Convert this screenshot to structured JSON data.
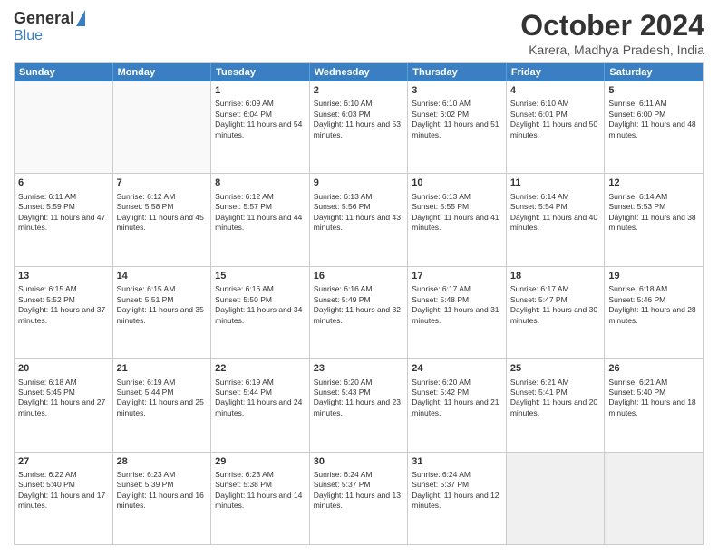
{
  "logo": {
    "general": "General",
    "blue": "Blue"
  },
  "header": {
    "month": "October 2024",
    "location": "Karera, Madhya Pradesh, India"
  },
  "weekdays": [
    "Sunday",
    "Monday",
    "Tuesday",
    "Wednesday",
    "Thursday",
    "Friday",
    "Saturday"
  ],
  "weeks": [
    [
      {
        "day": "",
        "sunrise": "",
        "sunset": "",
        "daylight": "",
        "empty": true
      },
      {
        "day": "",
        "sunrise": "",
        "sunset": "",
        "daylight": "",
        "empty": true
      },
      {
        "day": "1",
        "sunrise": "Sunrise: 6:09 AM",
        "sunset": "Sunset: 6:04 PM",
        "daylight": "Daylight: 11 hours and 54 minutes.",
        "empty": false
      },
      {
        "day": "2",
        "sunrise": "Sunrise: 6:10 AM",
        "sunset": "Sunset: 6:03 PM",
        "daylight": "Daylight: 11 hours and 53 minutes.",
        "empty": false
      },
      {
        "day": "3",
        "sunrise": "Sunrise: 6:10 AM",
        "sunset": "Sunset: 6:02 PM",
        "daylight": "Daylight: 11 hours and 51 minutes.",
        "empty": false
      },
      {
        "day": "4",
        "sunrise": "Sunrise: 6:10 AM",
        "sunset": "Sunset: 6:01 PM",
        "daylight": "Daylight: 11 hours and 50 minutes.",
        "empty": false
      },
      {
        "day": "5",
        "sunrise": "Sunrise: 6:11 AM",
        "sunset": "Sunset: 6:00 PM",
        "daylight": "Daylight: 11 hours and 48 minutes.",
        "empty": false
      }
    ],
    [
      {
        "day": "6",
        "sunrise": "Sunrise: 6:11 AM",
        "sunset": "Sunset: 5:59 PM",
        "daylight": "Daylight: 11 hours and 47 minutes.",
        "empty": false
      },
      {
        "day": "7",
        "sunrise": "Sunrise: 6:12 AM",
        "sunset": "Sunset: 5:58 PM",
        "daylight": "Daylight: 11 hours and 45 minutes.",
        "empty": false
      },
      {
        "day": "8",
        "sunrise": "Sunrise: 6:12 AM",
        "sunset": "Sunset: 5:57 PM",
        "daylight": "Daylight: 11 hours and 44 minutes.",
        "empty": false
      },
      {
        "day": "9",
        "sunrise": "Sunrise: 6:13 AM",
        "sunset": "Sunset: 5:56 PM",
        "daylight": "Daylight: 11 hours and 43 minutes.",
        "empty": false
      },
      {
        "day": "10",
        "sunrise": "Sunrise: 6:13 AM",
        "sunset": "Sunset: 5:55 PM",
        "daylight": "Daylight: 11 hours and 41 minutes.",
        "empty": false
      },
      {
        "day": "11",
        "sunrise": "Sunrise: 6:14 AM",
        "sunset": "Sunset: 5:54 PM",
        "daylight": "Daylight: 11 hours and 40 minutes.",
        "empty": false
      },
      {
        "day": "12",
        "sunrise": "Sunrise: 6:14 AM",
        "sunset": "Sunset: 5:53 PM",
        "daylight": "Daylight: 11 hours and 38 minutes.",
        "empty": false
      }
    ],
    [
      {
        "day": "13",
        "sunrise": "Sunrise: 6:15 AM",
        "sunset": "Sunset: 5:52 PM",
        "daylight": "Daylight: 11 hours and 37 minutes.",
        "empty": false
      },
      {
        "day": "14",
        "sunrise": "Sunrise: 6:15 AM",
        "sunset": "Sunset: 5:51 PM",
        "daylight": "Daylight: 11 hours and 35 minutes.",
        "empty": false
      },
      {
        "day": "15",
        "sunrise": "Sunrise: 6:16 AM",
        "sunset": "Sunset: 5:50 PM",
        "daylight": "Daylight: 11 hours and 34 minutes.",
        "empty": false
      },
      {
        "day": "16",
        "sunrise": "Sunrise: 6:16 AM",
        "sunset": "Sunset: 5:49 PM",
        "daylight": "Daylight: 11 hours and 32 minutes.",
        "empty": false
      },
      {
        "day": "17",
        "sunrise": "Sunrise: 6:17 AM",
        "sunset": "Sunset: 5:48 PM",
        "daylight": "Daylight: 11 hours and 31 minutes.",
        "empty": false
      },
      {
        "day": "18",
        "sunrise": "Sunrise: 6:17 AM",
        "sunset": "Sunset: 5:47 PM",
        "daylight": "Daylight: 11 hours and 30 minutes.",
        "empty": false
      },
      {
        "day": "19",
        "sunrise": "Sunrise: 6:18 AM",
        "sunset": "Sunset: 5:46 PM",
        "daylight": "Daylight: 11 hours and 28 minutes.",
        "empty": false
      }
    ],
    [
      {
        "day": "20",
        "sunrise": "Sunrise: 6:18 AM",
        "sunset": "Sunset: 5:45 PM",
        "daylight": "Daylight: 11 hours and 27 minutes.",
        "empty": false
      },
      {
        "day": "21",
        "sunrise": "Sunrise: 6:19 AM",
        "sunset": "Sunset: 5:44 PM",
        "daylight": "Daylight: 11 hours and 25 minutes.",
        "empty": false
      },
      {
        "day": "22",
        "sunrise": "Sunrise: 6:19 AM",
        "sunset": "Sunset: 5:44 PM",
        "daylight": "Daylight: 11 hours and 24 minutes.",
        "empty": false
      },
      {
        "day": "23",
        "sunrise": "Sunrise: 6:20 AM",
        "sunset": "Sunset: 5:43 PM",
        "daylight": "Daylight: 11 hours and 23 minutes.",
        "empty": false
      },
      {
        "day": "24",
        "sunrise": "Sunrise: 6:20 AM",
        "sunset": "Sunset: 5:42 PM",
        "daylight": "Daylight: 11 hours and 21 minutes.",
        "empty": false
      },
      {
        "day": "25",
        "sunrise": "Sunrise: 6:21 AM",
        "sunset": "Sunset: 5:41 PM",
        "daylight": "Daylight: 11 hours and 20 minutes.",
        "empty": false
      },
      {
        "day": "26",
        "sunrise": "Sunrise: 6:21 AM",
        "sunset": "Sunset: 5:40 PM",
        "daylight": "Daylight: 11 hours and 18 minutes.",
        "empty": false
      }
    ],
    [
      {
        "day": "27",
        "sunrise": "Sunrise: 6:22 AM",
        "sunset": "Sunset: 5:40 PM",
        "daylight": "Daylight: 11 hours and 17 minutes.",
        "empty": false
      },
      {
        "day": "28",
        "sunrise": "Sunrise: 6:23 AM",
        "sunset": "Sunset: 5:39 PM",
        "daylight": "Daylight: 11 hours and 16 minutes.",
        "empty": false
      },
      {
        "day": "29",
        "sunrise": "Sunrise: 6:23 AM",
        "sunset": "Sunset: 5:38 PM",
        "daylight": "Daylight: 11 hours and 14 minutes.",
        "empty": false
      },
      {
        "day": "30",
        "sunrise": "Sunrise: 6:24 AM",
        "sunset": "Sunset: 5:37 PM",
        "daylight": "Daylight: 11 hours and 13 minutes.",
        "empty": false
      },
      {
        "day": "31",
        "sunrise": "Sunrise: 6:24 AM",
        "sunset": "Sunset: 5:37 PM",
        "daylight": "Daylight: 11 hours and 12 minutes.",
        "empty": false
      },
      {
        "day": "",
        "sunrise": "",
        "sunset": "",
        "daylight": "",
        "empty": true
      },
      {
        "day": "",
        "sunrise": "",
        "sunset": "",
        "daylight": "",
        "empty": true
      }
    ]
  ]
}
